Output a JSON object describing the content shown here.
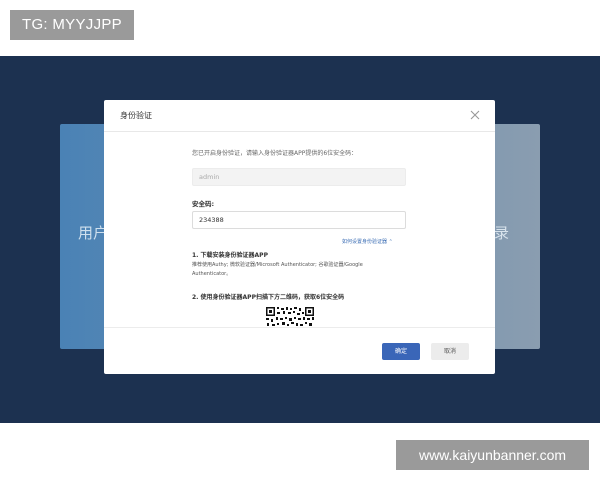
{
  "watermark_top": "TG: MYYJJPP",
  "watermark_bottom": "www.kaiyunbanner.com",
  "background": {
    "left_text": "用户",
    "right_text": "录"
  },
  "modal": {
    "title": "身份验证",
    "intro": "您已开启身份验证，请输入身份验证器APP提供的6位安全码：",
    "username_value": "admin",
    "code_label": "安全码:",
    "code_value": "234388",
    "help_link": "如何设置身份验证器 ⌃",
    "step1_title": "1. 下载安装身份验证器APP",
    "step1_desc": "推荐使用Authy; 微软验证器/Microsoft Authenticator; 谷歌验证器/Google Authenticator。",
    "step2_title": "2. 使用身份验证器APP扫描下方二维码，获取6位安全码",
    "confirm_label": "确定",
    "cancel_label": "取消"
  },
  "colors": {
    "backdrop": "#1c3150",
    "primary_button": "#3a66b8",
    "link": "#3e6fb5"
  },
  "icons": [
    "close-icon",
    "qr-code-icon"
  ]
}
